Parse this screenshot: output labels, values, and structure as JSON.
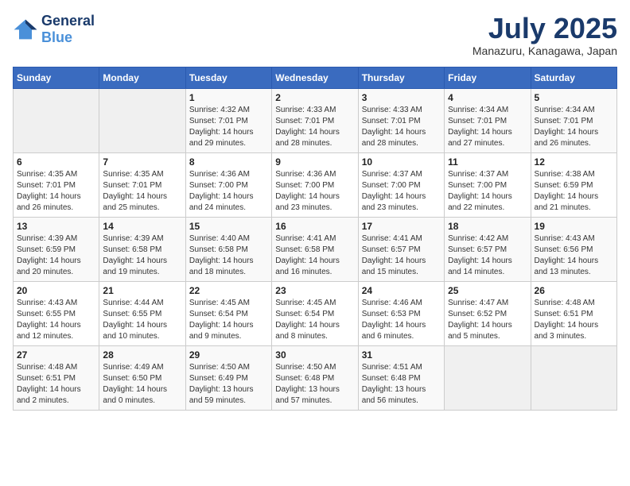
{
  "header": {
    "logo_line1": "General",
    "logo_line2": "Blue",
    "month_year": "July 2025",
    "location": "Manazuru, Kanagawa, Japan"
  },
  "weekdays": [
    "Sunday",
    "Monday",
    "Tuesday",
    "Wednesday",
    "Thursday",
    "Friday",
    "Saturday"
  ],
  "weeks": [
    [
      {
        "day": "",
        "info": ""
      },
      {
        "day": "",
        "info": ""
      },
      {
        "day": "1",
        "info": "Sunrise: 4:32 AM\nSunset: 7:01 PM\nDaylight: 14 hours and 29 minutes."
      },
      {
        "day": "2",
        "info": "Sunrise: 4:33 AM\nSunset: 7:01 PM\nDaylight: 14 hours and 28 minutes."
      },
      {
        "day": "3",
        "info": "Sunrise: 4:33 AM\nSunset: 7:01 PM\nDaylight: 14 hours and 28 minutes."
      },
      {
        "day": "4",
        "info": "Sunrise: 4:34 AM\nSunset: 7:01 PM\nDaylight: 14 hours and 27 minutes."
      },
      {
        "day": "5",
        "info": "Sunrise: 4:34 AM\nSunset: 7:01 PM\nDaylight: 14 hours and 26 minutes."
      }
    ],
    [
      {
        "day": "6",
        "info": "Sunrise: 4:35 AM\nSunset: 7:01 PM\nDaylight: 14 hours and 26 minutes."
      },
      {
        "day": "7",
        "info": "Sunrise: 4:35 AM\nSunset: 7:01 PM\nDaylight: 14 hours and 25 minutes."
      },
      {
        "day": "8",
        "info": "Sunrise: 4:36 AM\nSunset: 7:00 PM\nDaylight: 14 hours and 24 minutes."
      },
      {
        "day": "9",
        "info": "Sunrise: 4:36 AM\nSunset: 7:00 PM\nDaylight: 14 hours and 23 minutes."
      },
      {
        "day": "10",
        "info": "Sunrise: 4:37 AM\nSunset: 7:00 PM\nDaylight: 14 hours and 23 minutes."
      },
      {
        "day": "11",
        "info": "Sunrise: 4:37 AM\nSunset: 7:00 PM\nDaylight: 14 hours and 22 minutes."
      },
      {
        "day": "12",
        "info": "Sunrise: 4:38 AM\nSunset: 6:59 PM\nDaylight: 14 hours and 21 minutes."
      }
    ],
    [
      {
        "day": "13",
        "info": "Sunrise: 4:39 AM\nSunset: 6:59 PM\nDaylight: 14 hours and 20 minutes."
      },
      {
        "day": "14",
        "info": "Sunrise: 4:39 AM\nSunset: 6:58 PM\nDaylight: 14 hours and 19 minutes."
      },
      {
        "day": "15",
        "info": "Sunrise: 4:40 AM\nSunset: 6:58 PM\nDaylight: 14 hours and 18 minutes."
      },
      {
        "day": "16",
        "info": "Sunrise: 4:41 AM\nSunset: 6:58 PM\nDaylight: 14 hours and 16 minutes."
      },
      {
        "day": "17",
        "info": "Sunrise: 4:41 AM\nSunset: 6:57 PM\nDaylight: 14 hours and 15 minutes."
      },
      {
        "day": "18",
        "info": "Sunrise: 4:42 AM\nSunset: 6:57 PM\nDaylight: 14 hours and 14 minutes."
      },
      {
        "day": "19",
        "info": "Sunrise: 4:43 AM\nSunset: 6:56 PM\nDaylight: 14 hours and 13 minutes."
      }
    ],
    [
      {
        "day": "20",
        "info": "Sunrise: 4:43 AM\nSunset: 6:55 PM\nDaylight: 14 hours and 12 minutes."
      },
      {
        "day": "21",
        "info": "Sunrise: 4:44 AM\nSunset: 6:55 PM\nDaylight: 14 hours and 10 minutes."
      },
      {
        "day": "22",
        "info": "Sunrise: 4:45 AM\nSunset: 6:54 PM\nDaylight: 14 hours and 9 minutes."
      },
      {
        "day": "23",
        "info": "Sunrise: 4:45 AM\nSunset: 6:54 PM\nDaylight: 14 hours and 8 minutes."
      },
      {
        "day": "24",
        "info": "Sunrise: 4:46 AM\nSunset: 6:53 PM\nDaylight: 14 hours and 6 minutes."
      },
      {
        "day": "25",
        "info": "Sunrise: 4:47 AM\nSunset: 6:52 PM\nDaylight: 14 hours and 5 minutes."
      },
      {
        "day": "26",
        "info": "Sunrise: 4:48 AM\nSunset: 6:51 PM\nDaylight: 14 hours and 3 minutes."
      }
    ],
    [
      {
        "day": "27",
        "info": "Sunrise: 4:48 AM\nSunset: 6:51 PM\nDaylight: 14 hours and 2 minutes."
      },
      {
        "day": "28",
        "info": "Sunrise: 4:49 AM\nSunset: 6:50 PM\nDaylight: 14 hours and 0 minutes."
      },
      {
        "day": "29",
        "info": "Sunrise: 4:50 AM\nSunset: 6:49 PM\nDaylight: 13 hours and 59 minutes."
      },
      {
        "day": "30",
        "info": "Sunrise: 4:50 AM\nSunset: 6:48 PM\nDaylight: 13 hours and 57 minutes."
      },
      {
        "day": "31",
        "info": "Sunrise: 4:51 AM\nSunset: 6:48 PM\nDaylight: 13 hours and 56 minutes."
      },
      {
        "day": "",
        "info": ""
      },
      {
        "day": "",
        "info": ""
      }
    ]
  ]
}
